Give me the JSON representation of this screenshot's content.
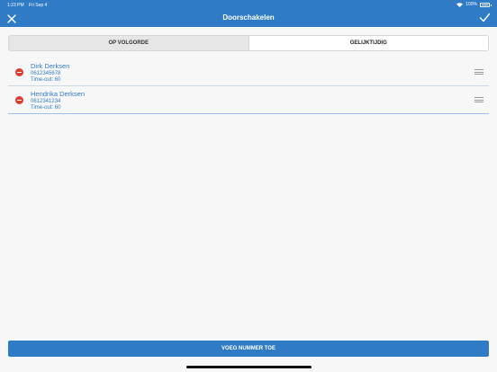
{
  "status_bar": {
    "time": "1:23 PM",
    "date": "Fri Sep 4",
    "battery": "100%"
  },
  "header": {
    "title": "Doorschakelen"
  },
  "segments": [
    {
      "label": "OP VOLGORDE",
      "active": false
    },
    {
      "label": "GELIJKTIJDIG",
      "active": true
    }
  ],
  "contacts": [
    {
      "name": "Dirk Derksen",
      "number": "0612345678",
      "timeout": "Time-out: 60"
    },
    {
      "name": "Hendrika Derksen",
      "number": "0612341234",
      "timeout": "Time-out: 60"
    }
  ],
  "footer": {
    "add_label": "VOEG NUMMER TOE"
  },
  "colors": {
    "primary": "#2f7bc6",
    "remove": "#e03c32",
    "background": "#f7f7f7"
  },
  "icons": {
    "close": "close-icon",
    "confirm": "checkmark-icon",
    "remove": "remove-circle-icon",
    "drag": "drag-handle-icon"
  }
}
